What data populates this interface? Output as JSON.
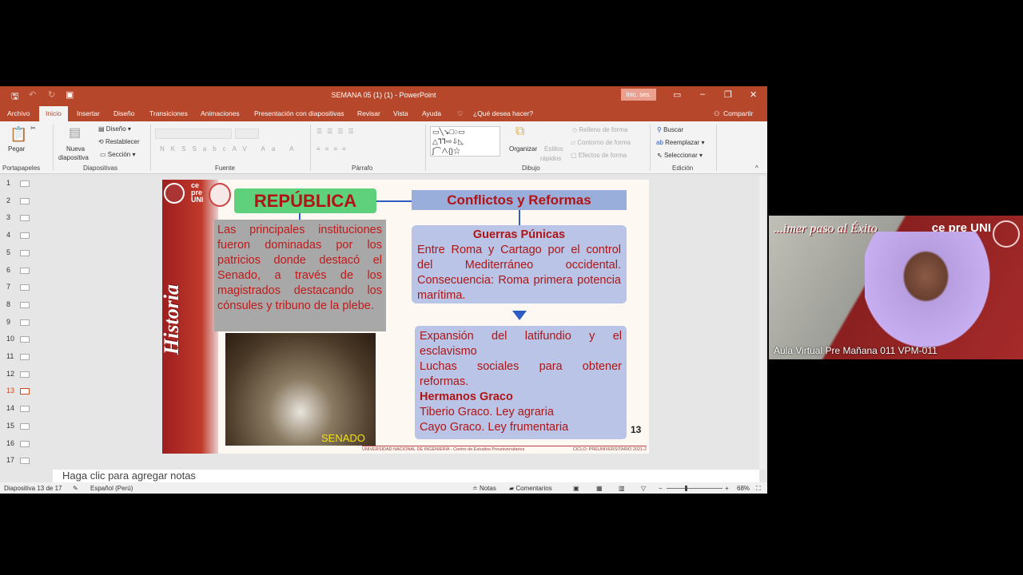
{
  "window": {
    "title": "SEMANA 05 (1) (1)  -  PowerPoint",
    "signin": "Inic. ses."
  },
  "tabs": [
    "Archivo",
    "Inicio",
    "Insertar",
    "Diseño",
    "Transiciones",
    "Animaciones",
    "Presentación con diapositivas",
    "Revisar",
    "Vista",
    "Ayuda"
  ],
  "tell_me": "¿Qué desea hacer?",
  "share": "Compartir",
  "ribbon": {
    "pegar": "Pegar",
    "portapapeles": "Portapapeles",
    "nueva": "Nueva",
    "diapositiva": "diapositiva",
    "diseno": "Diseño",
    "restablecer": "Restablecer",
    "seccion": "Sección",
    "diapositivas": "Diapositivas",
    "fuente": "Fuente",
    "parrafo": "Párrafo",
    "organizar": "Organizar",
    "estilos": "Estilos",
    "rapidos": "rápidos",
    "relleno": "Relleno de forma",
    "contorno": "Contorno de forma",
    "efectos": "Efectos de forma",
    "dibujo": "Dibujo",
    "buscar": "Buscar",
    "reemplazar": "Reemplazar",
    "seleccionar": "Seleccionar",
    "edicion": "Edición"
  },
  "thumbnails": [
    "1",
    "2",
    "3",
    "4",
    "5",
    "6",
    "7",
    "8",
    "9",
    "10",
    "11",
    "12",
    "13",
    "14",
    "15",
    "16",
    "17"
  ],
  "selected_slide": 13,
  "slide": {
    "side_title": "Historia",
    "logo_text": "ce pre UNI",
    "republica": "REPÚBLICA",
    "conflictos": "Conflictos y Reformas",
    "republica_text": "Las principales instituciones fueron dominadas por los patricios  donde destacó el Senado, a través de los magistrados destacando los cónsules y tribuno de la plebe.",
    "photo_caption": "SENADO",
    "guerras_title": "Guerras Púnicas",
    "guerras_text": "Entre Roma  y Cartago por el control del Mediterráneo occidental. Consecuencia: Roma primera potencia marítima.",
    "exp_1": "Expansión del latifundio y el esclavismo",
    "exp_2": "Luchas sociales para obtener reformas.",
    "graco_title": "Hermanos Graco",
    "graco_1": "Tiberio Graco. Ley agraria",
    "graco_2": "Cayo Graco.  Ley frumentaria",
    "page_number": "13",
    "footer_left": "UNIVERSIDAD NACIONAL DE INGENIERÍA  -  Centro de Estudios Preuniversitarios",
    "footer_right": "CICLO: PREUNIVERSITARIO 2021-2"
  },
  "notes_placeholder": "Haga clic para agregar notas",
  "status": {
    "slide": "Diapositiva 13 de 17",
    "language": "Español (Perú)",
    "notas": "Notas",
    "comentarios": "Comentarios",
    "zoom": "68%",
    "zoom_level": 68
  },
  "webcam": {
    "label": "Aula Virtual Pre Mañana 011 VPM-011",
    "motto": "...imer paso al Éxito",
    "logo": "ce pre UNI"
  }
}
